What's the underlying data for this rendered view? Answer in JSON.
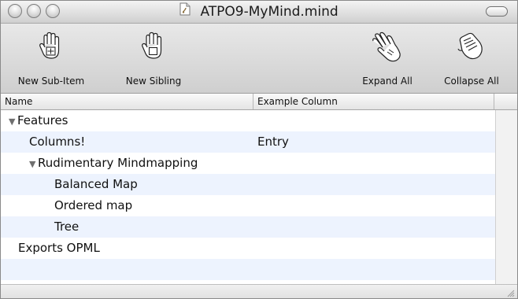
{
  "window": {
    "title": "ATPO9-MyMind.mind",
    "controls": [
      "close-button",
      "minimize-button",
      "zoom-button"
    ]
  },
  "toolbar": {
    "items": [
      {
        "label": "New Sub-Item",
        "icon": "hand-add-child-icon"
      },
      {
        "label": "New Sibling",
        "icon": "hand-add-sibling-icon"
      },
      {
        "label": "Expand All",
        "icon": "open-hand-icon"
      },
      {
        "label": "Collapse All",
        "icon": "closed-hand-icon"
      }
    ]
  },
  "table": {
    "columns": [
      "Name",
      "Example Column"
    ],
    "rows": [
      {
        "name": "Features",
        "value": "",
        "level": 0,
        "expanded": true
      },
      {
        "name": "Columns!",
        "value": "Entry",
        "level": 1
      },
      {
        "name": "Rudimentary Mindmapping",
        "value": "",
        "level": 1,
        "expanded": true
      },
      {
        "name": "Balanced Map",
        "value": "",
        "level": 2
      },
      {
        "name": "Ordered map",
        "value": "",
        "level": 2
      },
      {
        "name": "Tree",
        "value": "",
        "level": 2
      },
      {
        "name": "Exports OPML",
        "value": "",
        "level": 0
      },
      {
        "name": "",
        "value": "",
        "level": 0
      }
    ]
  },
  "colors": {
    "alt_row": "#edf3fe",
    "toolbar_top": "#e8e8e8",
    "toolbar_bottom": "#cfcfcf"
  }
}
